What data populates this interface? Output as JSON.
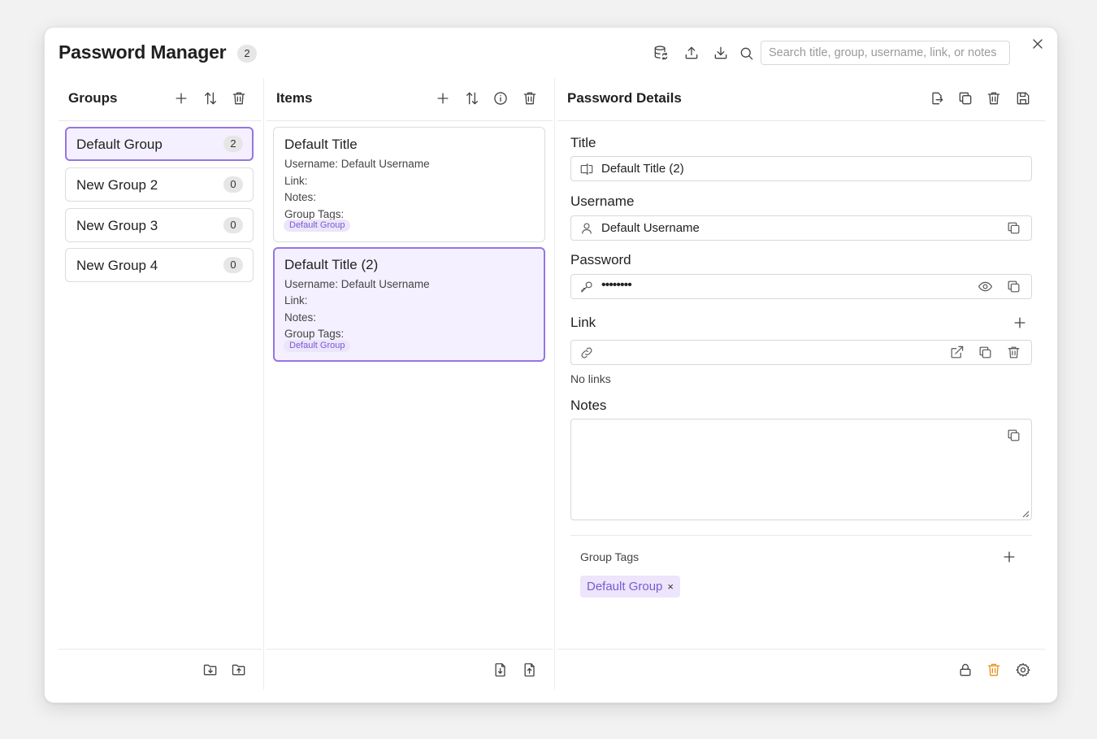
{
  "app": {
    "title": "Password Manager",
    "count": "2",
    "search_placeholder": "Search title, group, username, link, or notes"
  },
  "groups": {
    "title": "Groups",
    "items": [
      {
        "name": "Default Group",
        "count": "2",
        "active": true
      },
      {
        "name": "New Group 2",
        "count": "0",
        "active": false
      },
      {
        "name": "New Group 3",
        "count": "0",
        "active": false
      },
      {
        "name": "New Group 4",
        "count": "0",
        "active": false
      }
    ]
  },
  "items": {
    "title": "Items",
    "list": [
      {
        "title": "Default Title",
        "username_row": "Username:  Default Username",
        "link_row": "Link:",
        "notes_row": "Notes:",
        "tags_row": "Group Tags:",
        "tag": "Default Group",
        "active": false
      },
      {
        "title": "Default Title (2)",
        "username_row": "Username:  Default Username",
        "link_row": "Link:",
        "notes_row": "Notes:",
        "tags_row": "Group Tags:",
        "tag": "Default Group",
        "active": true
      }
    ]
  },
  "details": {
    "title": "Password Details",
    "title_label": "Title",
    "title_value": "Default Title (2)",
    "username_label": "Username",
    "username_value": "Default Username",
    "password_label": "Password",
    "password_value": "••••••••",
    "link_label": "Link",
    "link_empty": "No links",
    "notes_label": "Notes",
    "notes_value": "",
    "group_tags_label": "Group Tags",
    "group_tag": "Default Group",
    "tag_remove": "×"
  },
  "colors": {
    "accent": "#9575e4",
    "accent_bg": "#f4f0ff",
    "tag_bg": "#ece5fb",
    "tag_text": "#7a5ad1",
    "danger": "#e8901a"
  },
  "icons": {
    "header": [
      "database-sync-icon",
      "upload-icon",
      "download-icon",
      "search-icon",
      "close-icon"
    ],
    "groups_toolbar": [
      "plus-icon",
      "sort-icon",
      "trash-icon"
    ],
    "items_toolbar": [
      "plus-icon",
      "sort-icon",
      "info-icon",
      "trash-icon"
    ],
    "details_toolbar": [
      "export-icon",
      "copy-icon",
      "trash-icon",
      "save-icon"
    ],
    "footer_right": [
      "lock-icon",
      "trash-icon",
      "gear-icon"
    ]
  }
}
